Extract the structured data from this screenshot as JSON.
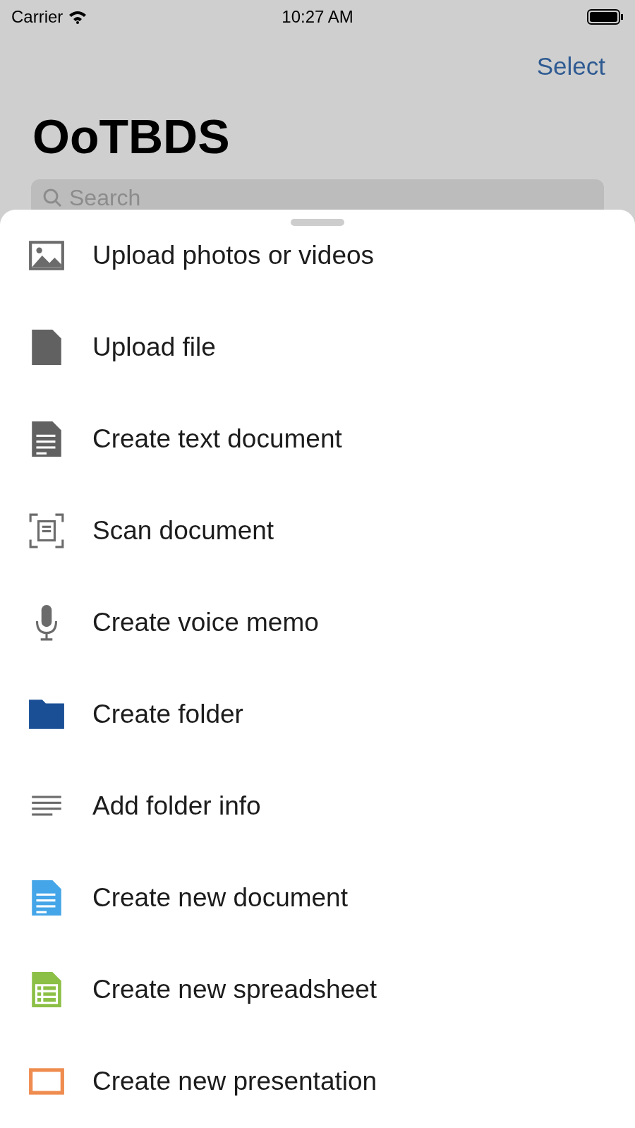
{
  "status_bar": {
    "carrier": "Carrier",
    "time": "10:27 AM"
  },
  "nav": {
    "action": "Select",
    "title": "OoTBDS"
  },
  "search": {
    "placeholder": "Search"
  },
  "sheet": {
    "items": [
      {
        "kind": "photo",
        "label": "Upload photos or videos"
      },
      {
        "kind": "file",
        "label": "Upload file"
      },
      {
        "kind": "text-document",
        "label": "Create text document"
      },
      {
        "kind": "scan",
        "label": "Scan document"
      },
      {
        "kind": "microphone",
        "label": "Create voice memo"
      },
      {
        "kind": "folder",
        "label": "Create folder"
      },
      {
        "kind": "lines",
        "label": "Add folder info"
      },
      {
        "kind": "document",
        "label": "Create new document"
      },
      {
        "kind": "spreadsheet",
        "label": "Create new spreadsheet"
      },
      {
        "kind": "presentation",
        "label": "Create new presentation"
      }
    ]
  }
}
